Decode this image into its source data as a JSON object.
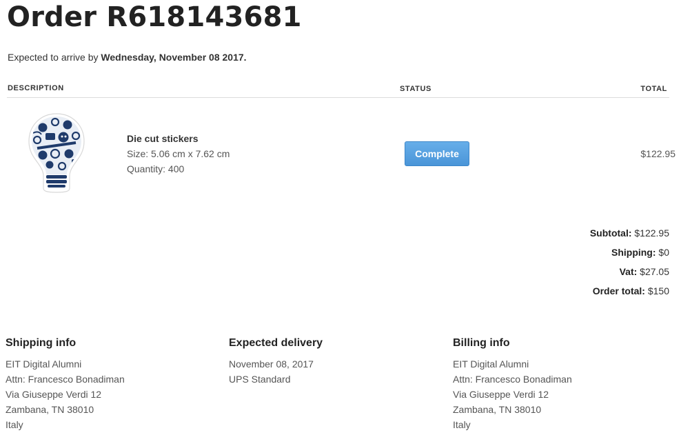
{
  "order": {
    "title": "Order R618143681",
    "expected_prefix": "Expected to arrive by ",
    "expected_date": "Wednesday, November 08 2017."
  },
  "table": {
    "headers": {
      "description": "DESCRIPTION",
      "status": "STATUS",
      "total": "TOTAL"
    },
    "item": {
      "image_icon": "lightbulb-sticker-image",
      "name": "Die cut stickers",
      "size": "Size: 5.06 cm x 7.62 cm",
      "quantity": "Quantity: 400",
      "status": "Complete",
      "total": "$122.95"
    }
  },
  "totals": {
    "subtotal_label": "Subtotal:",
    "subtotal_value": "$122.95",
    "shipping_label": "Shipping:",
    "shipping_value": "$0",
    "vat_label": "Vat:",
    "vat_value": "$27.05",
    "order_total_label": "Order total:",
    "order_total_value": "$150"
  },
  "shipping_info": {
    "heading": "Shipping info",
    "lines": [
      "EIT Digital Alumni",
      "Attn: Francesco Bonadiman",
      "Via Giuseppe Verdi 12",
      "Zambana, TN 38010",
      "Italy"
    ]
  },
  "expected_delivery": {
    "heading": "Expected delivery",
    "lines": [
      "November 08, 2017",
      "UPS Standard"
    ]
  },
  "billing_info": {
    "heading": "Billing info",
    "lines": [
      "EIT Digital Alumni",
      "Attn: Francesco Bonadiman",
      "Via Giuseppe Verdi 12",
      "Zambana, TN 38010",
      "Italy"
    ]
  },
  "colors": {
    "accent_button": "#4a95d8",
    "sticker_navy": "#1f3b6b"
  }
}
